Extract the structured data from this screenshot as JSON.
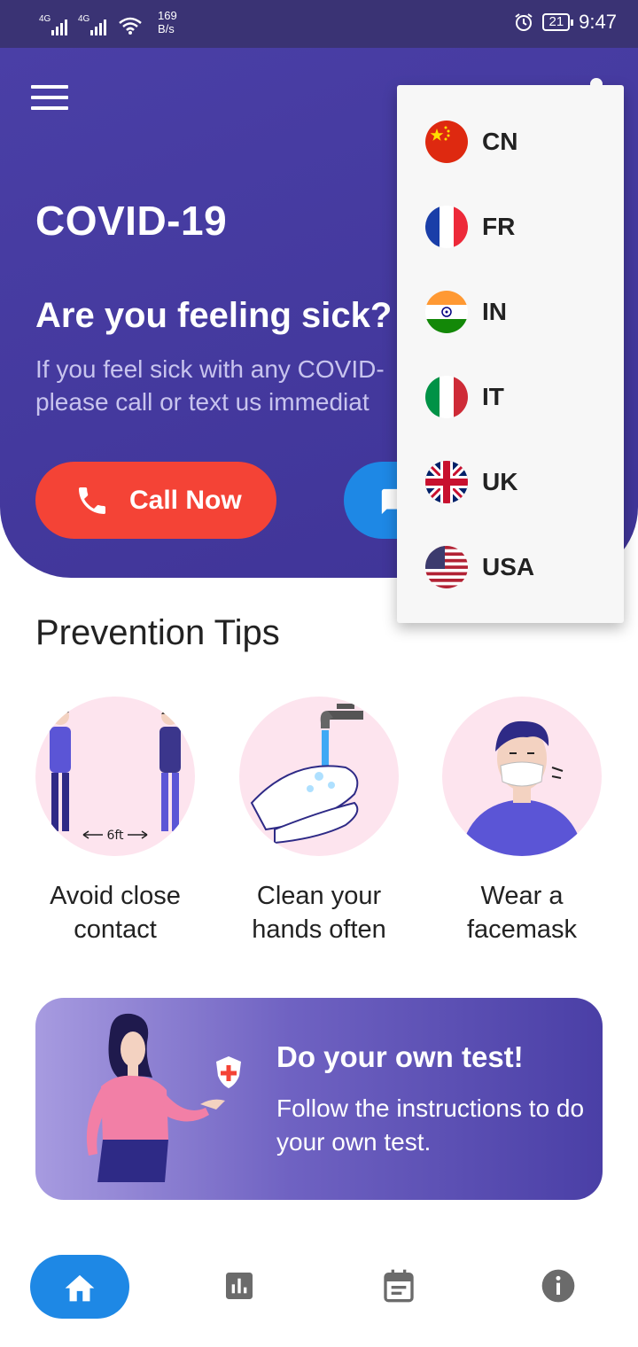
{
  "status_bar": {
    "signal_1": "4G",
    "signal_2": "4G",
    "speed_value": "169",
    "speed_unit": "B/s",
    "battery": "21",
    "time": "9:47"
  },
  "hero": {
    "title": "COVID-19",
    "question": "Are you feeling sick?",
    "desc_line1": "If you feel sick with any COVID-",
    "desc_line2": "please call or text us immediat",
    "call_label": "Call Now"
  },
  "language_menu": {
    "items": [
      {
        "code": "CN",
        "flag": "china-flag-icon"
      },
      {
        "code": "FR",
        "flag": "france-flag-icon"
      },
      {
        "code": "IN",
        "flag": "india-flag-icon"
      },
      {
        "code": "IT",
        "flag": "italy-flag-icon"
      },
      {
        "code": "UK",
        "flag": "uk-flag-icon"
      },
      {
        "code": "USA",
        "flag": "usa-flag-icon"
      }
    ]
  },
  "prevention": {
    "title": "Prevention Tips",
    "distance_label": "6ft",
    "tips": [
      {
        "line1": "Avoid close",
        "line2": "contact"
      },
      {
        "line1": "Clean your",
        "line2": "hands often"
      },
      {
        "line1": "Wear a",
        "line2": "facemask"
      }
    ]
  },
  "test_card": {
    "title": "Do your own test!",
    "desc": "Follow the instructions to do your own test."
  },
  "bottom_nav": {
    "items": [
      "home-icon",
      "stats-icon",
      "calendar-icon",
      "info-icon"
    ],
    "active": "home"
  },
  "colors": {
    "primary": "#4a3fa6",
    "call": "#f44336",
    "accent_blue": "#1e88e5",
    "tip_bg": "#fde4ee"
  }
}
